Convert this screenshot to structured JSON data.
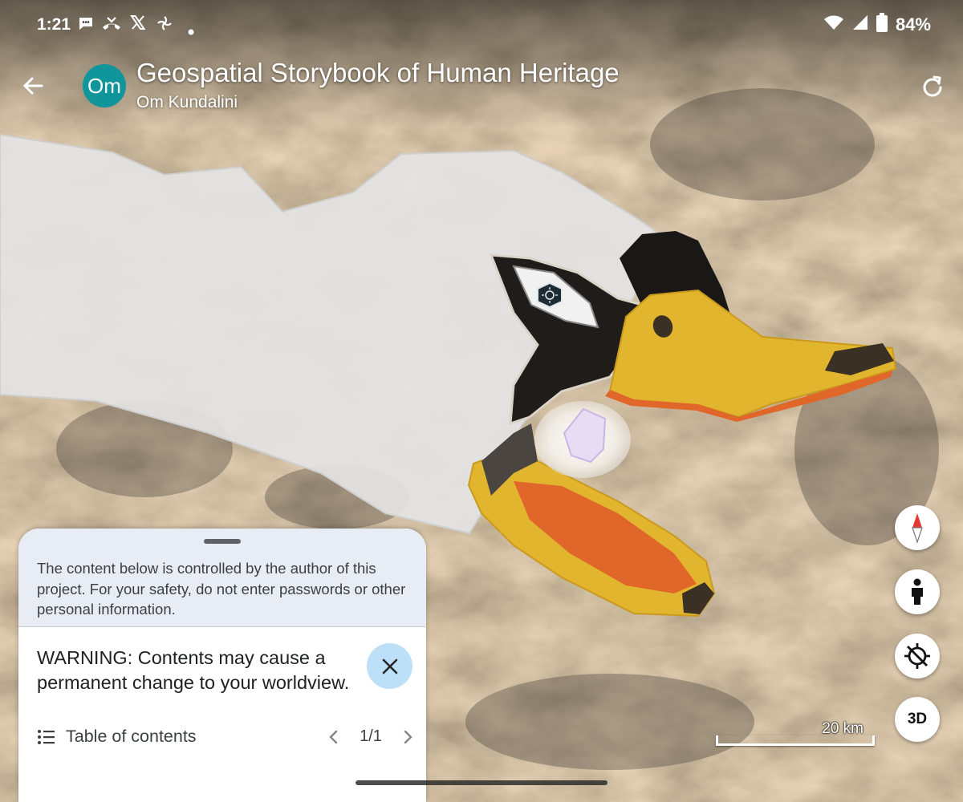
{
  "status_bar": {
    "time": "1:21",
    "battery": "84%",
    "notification_icons": [
      "chat-bubble-icon",
      "missed-call-icon",
      "x-logo-icon",
      "photos-icon",
      "dot-icon"
    ]
  },
  "header": {
    "avatar_initials": "Om",
    "title": "Geospatial Storybook of Human Heritage",
    "author": "Om Kundalini"
  },
  "sheet": {
    "notice": "The content below is controlled by the author of this project. For your safety, do not enter passwords or other personal information.",
    "warning": "WARNING: Contents may cause a permanent change to your worldview.",
    "toc_label": "Table of contents",
    "page_indicator": "1/1"
  },
  "map_controls": {
    "view_3d_label": "3D",
    "scale_label": "20 km"
  },
  "colors": {
    "avatar_bg": "#10969a",
    "close_button_bg": "#b9dff8",
    "beak_yellow": "#e2b52e",
    "beak_orange": "#e0662a"
  }
}
